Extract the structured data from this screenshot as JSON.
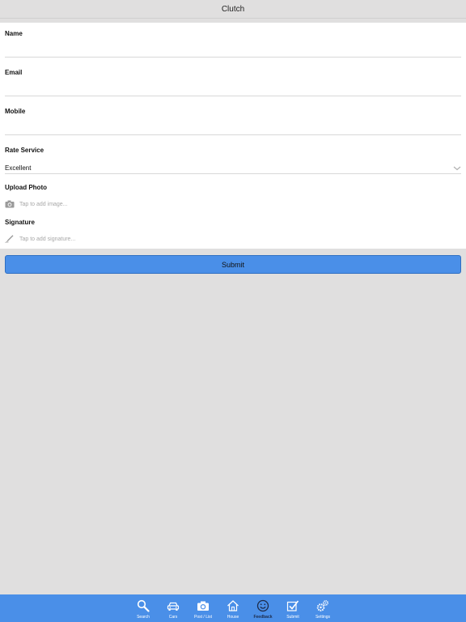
{
  "app": {
    "title": "Clutch"
  },
  "form": {
    "name": {
      "label": "Name",
      "value": ""
    },
    "email": {
      "label": "Email",
      "value": ""
    },
    "mobile": {
      "label": "Mobile",
      "value": ""
    },
    "rate_service": {
      "label": "Rate Service",
      "selected": "Excellent"
    },
    "upload_photo": {
      "label": "Upload Photo",
      "placeholder": "Tap to add image..."
    },
    "signature": {
      "label": "Signature",
      "placeholder": "Tap to add signature..."
    },
    "submit_label": "Submit"
  },
  "tabbar": {
    "items": [
      {
        "label": "Search",
        "icon": "search-icon"
      },
      {
        "label": "Cars",
        "icon": "car-icon"
      },
      {
        "label": "Post / List",
        "icon": "camera-icon"
      },
      {
        "label": "House",
        "icon": "house-icon"
      },
      {
        "label": "Feedback",
        "icon": "smiley-icon",
        "active": true
      },
      {
        "label": "Submit",
        "icon": "checkbox-icon"
      },
      {
        "label": "Settings",
        "icon": "gears-icon"
      }
    ]
  },
  "colors": {
    "accent": "#4a8fe8",
    "background": "#e0dfdf",
    "active_tab_label": "#1d2b4a"
  }
}
